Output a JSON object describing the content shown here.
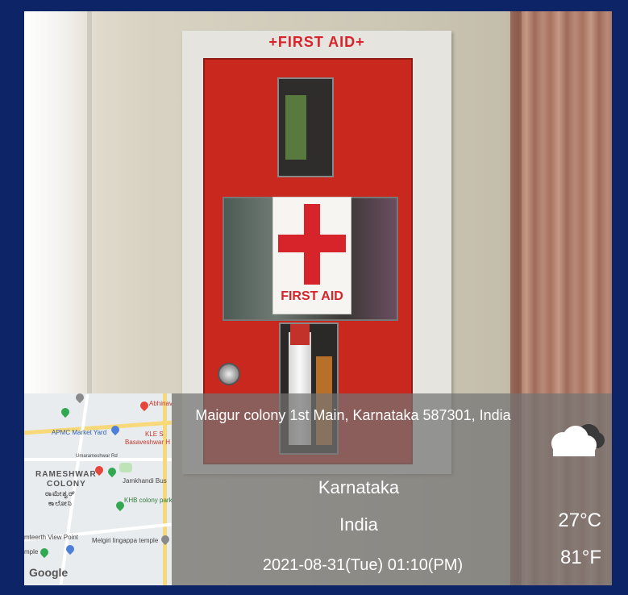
{
  "cabinet": {
    "header": "+FIRST AID+",
    "panel_label": "FIRST AID"
  },
  "stamp": {
    "address": "Maigur colony 1st Main, Karnataka 587301, India",
    "region": "Karnataka",
    "country": "India",
    "datetime": "2021-08-31(Tue)   01:10(PM)",
    "temp_c": "27°C",
    "temp_f": "81°F",
    "weather_icon": "cloudy-icon"
  },
  "map": {
    "labels": {
      "apmc": "APMC Market Yard",
      "abhinav": "Abhinav",
      "kle": "KLE S",
      "basaveshwar": "Basaveshwar H",
      "umarani": "Umarameshwar Rd",
      "rameshwar": "RAMESHWAR",
      "colony": "COLONY",
      "kannada_rameshwar": "ರಾಮೇಶ್ವರ್",
      "kannada_colony": "ಕಾಲೋನಿ",
      "jamkhandi": "Jamkhandi Bus",
      "khb": "KHB colony park",
      "amteerth": "mteerth View Point",
      "melgiri": "Melgiri lingappa temple",
      "temple": "mple",
      "google": "Google"
    },
    "colors": {
      "pin_red": "#e5453b",
      "pin_green": "#33a852",
      "pin_blue": "#4d7fd8",
      "road_yellow": "#f7d97a"
    }
  }
}
